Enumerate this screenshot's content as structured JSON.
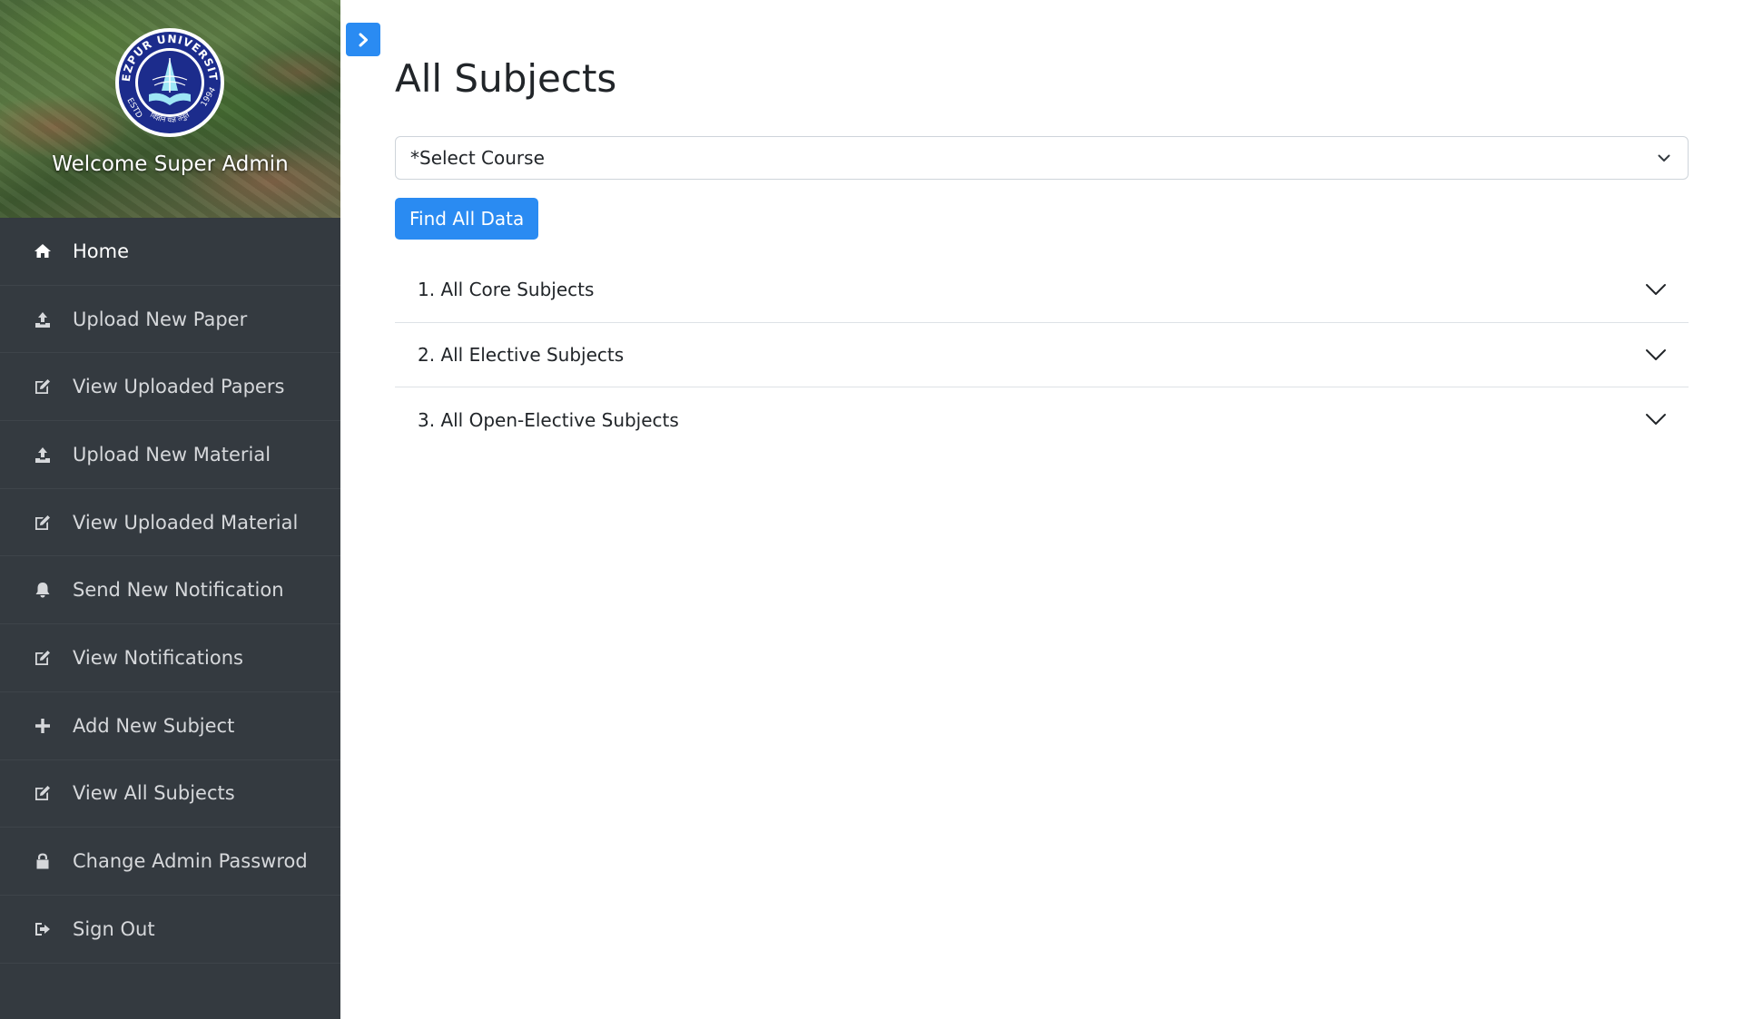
{
  "sidebar": {
    "logo": {
      "text": "TEZPUR UNIVERSITY",
      "year": "1994",
      "estd": "ESTD",
      "motto": "विज्ञानं यज्ञं तनुते"
    },
    "welcome": "Welcome Super Admin",
    "items": [
      {
        "label": "Home",
        "icon": "home-icon",
        "active": true
      },
      {
        "label": "Upload New Paper",
        "icon": "upload-icon"
      },
      {
        "label": "View Uploaded Papers",
        "icon": "edit-icon"
      },
      {
        "label": "Upload New Material",
        "icon": "upload-icon"
      },
      {
        "label": "View Uploaded Material",
        "icon": "edit-icon"
      },
      {
        "label": "Send New Notification",
        "icon": "bell-icon"
      },
      {
        "label": "View Notifications",
        "icon": "edit-icon"
      },
      {
        "label": "Add New Subject",
        "icon": "plus-icon"
      },
      {
        "label": "View All Subjects",
        "icon": "edit-icon"
      },
      {
        "label": "Change Admin Passwrod",
        "icon": "lock-icon"
      },
      {
        "label": "Sign Out",
        "icon": "sign-out-icon"
      }
    ]
  },
  "toggle": {
    "icon": "chevron-right-icon"
  },
  "main": {
    "title": "All Subjects",
    "course_select": {
      "value": "*Select Course"
    },
    "find_button": "Find All Data",
    "accordion": [
      {
        "label": "1. All Core Subjects"
      },
      {
        "label": "2. All Elective Subjects"
      },
      {
        "label": "3. All Open-Elective Subjects"
      }
    ]
  },
  "colors": {
    "sidebar_bg": "#343a40",
    "accent": "#2a8bf2",
    "logo_blue": "#1c2c8c"
  }
}
